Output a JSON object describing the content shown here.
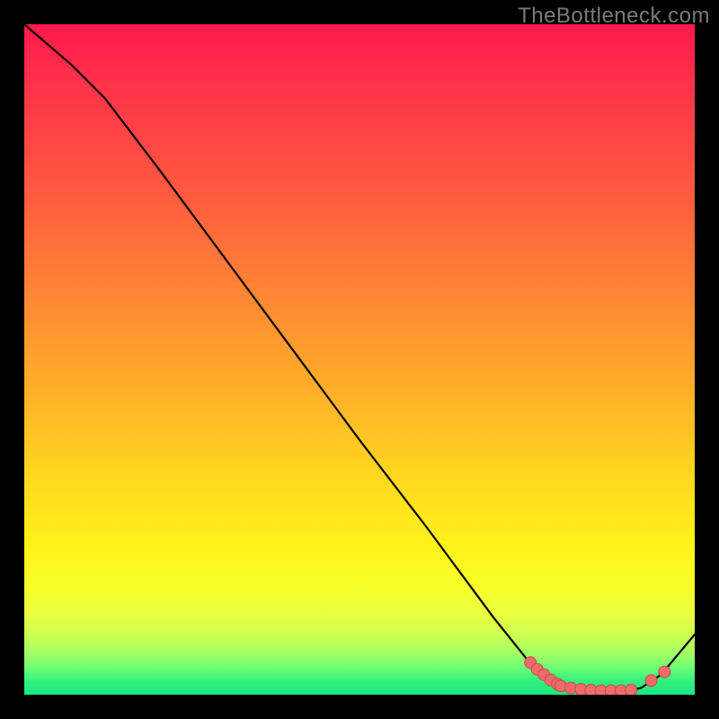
{
  "watermark": "TheBottleneck.com",
  "chart_data": {
    "type": "line",
    "title": "",
    "xlabel": "",
    "ylabel": "",
    "xlim": [
      0,
      100
    ],
    "ylim": [
      0,
      100
    ],
    "x": [
      0,
      7,
      12,
      20,
      30,
      40,
      50,
      60,
      70,
      76,
      80,
      82,
      84,
      86,
      88,
      90,
      92,
      95,
      100
    ],
    "y": [
      100,
      94,
      89,
      78.5,
      65,
      51.5,
      38,
      25,
      11.5,
      4,
      1.2,
      0.8,
      0.6,
      0.5,
      0.5,
      0.6,
      1.0,
      3,
      9
    ],
    "marker_points": {
      "x": [
        75.5,
        76.5,
        77.5,
        78.5,
        79.5,
        80,
        81.5,
        83,
        84.5,
        86,
        87.5,
        89,
        90.5,
        93.5,
        95.5
      ],
      "y": [
        4.8,
        3.8,
        3.0,
        2.2,
        1.6,
        1.3,
        1.0,
        0.8,
        0.7,
        0.6,
        0.6,
        0.6,
        0.7,
        2.1,
        3.4
      ]
    },
    "marker_color": "#ef6b6b",
    "gradient_colors": {
      "top": "#ff1a4d",
      "mid": "#fff31a",
      "bottom": "#17e884"
    }
  }
}
